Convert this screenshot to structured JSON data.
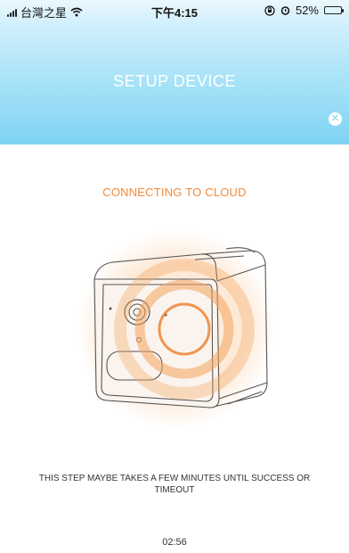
{
  "status_bar": {
    "carrier": "台灣之星",
    "time": "下午4:15",
    "battery": "52%",
    "battery_level": 0.52,
    "icons": [
      "signal-icon",
      "wifi-icon",
      "lock-rotation-icon",
      "alarm-icon",
      "battery-icon"
    ]
  },
  "header": {
    "title": "SETUP DEVICE",
    "close_icon": "close-icon"
  },
  "main": {
    "status_heading": "CONNECTING TO CLOUD",
    "hint": "THIS STEP MAYBE TAKES A FEW MINUTES UNTIL SUCCESS OR TIMEOUT",
    "timer": "02:56"
  },
  "colors": {
    "header_top": "#eaf7fd",
    "header_bottom": "#7fd3f3",
    "accent_orange": "#f08a3c"
  }
}
